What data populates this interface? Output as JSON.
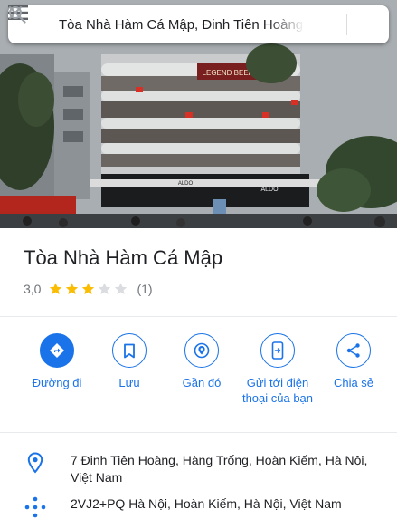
{
  "search": {
    "query": "Tòa Nhà Hàm Cá Mập, Đinh Tiên Hoàng"
  },
  "hero": {
    "sign_text": "LEGEND BEER",
    "brand_left": "ALDO",
    "brand_right": "ALDO"
  },
  "place": {
    "name": "Tòa Nhà Hàm Cá Mập",
    "rating": "3,0",
    "rating_value": 3,
    "rating_max": 5,
    "review_count": "(1)"
  },
  "actions": [
    {
      "label": "Đường đi",
      "icon": "directions-icon"
    },
    {
      "label": "Lưu",
      "icon": "bookmark-icon"
    },
    {
      "label": "Gần đó",
      "icon": "nearby-icon"
    },
    {
      "label": "Gửi tới điện thoại của bạn",
      "icon": "send-to-phone-icon"
    },
    {
      "label": "Chia sẻ",
      "icon": "share-icon"
    }
  ],
  "details": {
    "address": "7 Đinh Tiên Hoàng, Hàng Trống, Hoàn Kiếm, Hà Nội, Việt Nam",
    "plus_code": "2VJ2+PQ Hà Nội, Hoàn Kiếm, Hà Nội, Việt Nam"
  },
  "colors": {
    "accent": "#1a73e8",
    "star": "#fbbc04",
    "star_empty": "#dadce0",
    "text": "#202124",
    "secondary": "#70757a"
  }
}
